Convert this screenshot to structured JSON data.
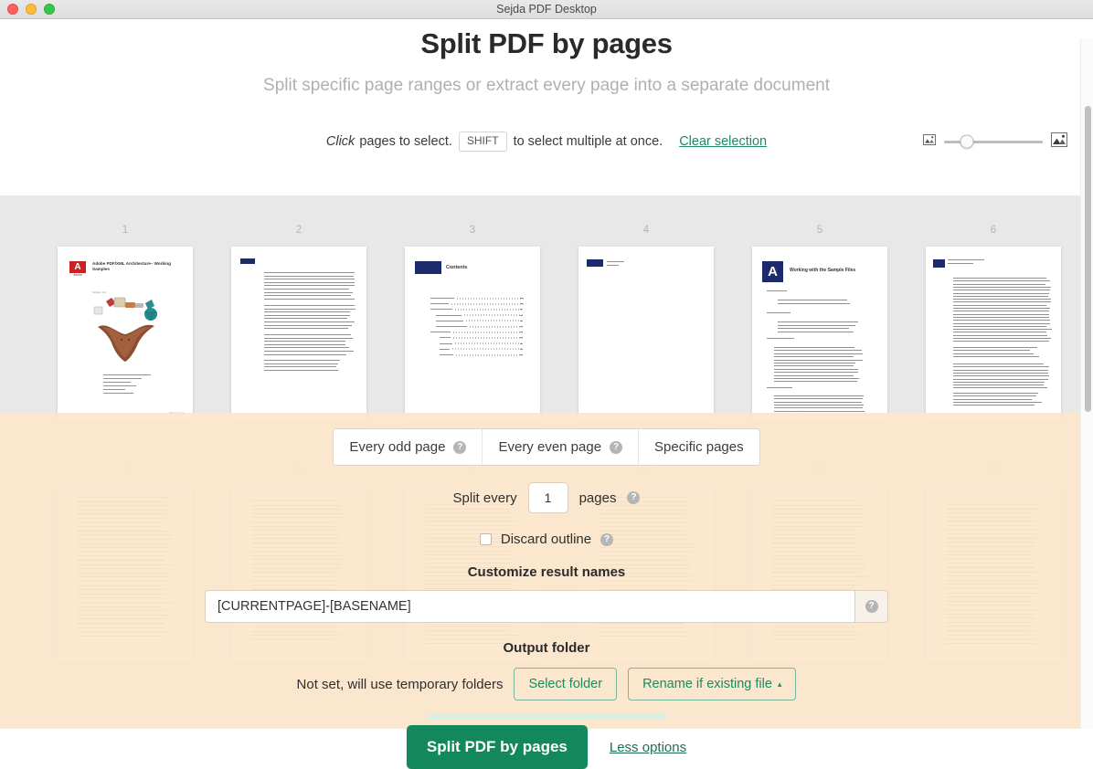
{
  "window": {
    "title": "Sejda PDF Desktop",
    "traffic_lights": [
      "close-red",
      "minimize-yellow",
      "maximize-green"
    ]
  },
  "header": {
    "title": "Split PDF by pages",
    "subtitle": "Split specific page ranges or extract every page into a separate document"
  },
  "select_bar": {
    "click_word": "Click",
    "text_before_kbd": "pages to select.",
    "kbd": "SHIFT",
    "text_after_kbd": "to select multiple at once.",
    "clear_selection": "Clear selection",
    "zoom": {
      "small_icon": "image-small-icon",
      "large_icon": "image-large-icon",
      "value_percent": 23
    }
  },
  "thumbnails": {
    "row1": [
      {
        "number": "1",
        "kind": "cover",
        "title": "Adobe PDF/XML Architecture– Working Samples",
        "logo": "adobe-logo",
        "footer": "Page 1 of 1"
      },
      {
        "number": "2",
        "kind": "text-page"
      },
      {
        "number": "3",
        "kind": "contents",
        "heading": "Contents"
      },
      {
        "number": "4",
        "kind": "sparse-page"
      },
      {
        "number": "5",
        "kind": "chapter",
        "badge": "A",
        "heading": "Working with the Sample Files"
      },
      {
        "number": "6",
        "kind": "dense-text",
        "heading": "Working with the Sample Files"
      }
    ],
    "row2": [
      {
        "number": "7",
        "kind": "text-page"
      },
      {
        "number": "8",
        "kind": "text-page"
      },
      {
        "number": "9",
        "kind": "text-page"
      },
      {
        "number": "10",
        "kind": "text-page"
      },
      {
        "number": "11",
        "kind": "text-page"
      },
      {
        "number": "12",
        "kind": "text-page"
      }
    ]
  },
  "options": {
    "tabs": [
      {
        "label": "Every odd page",
        "has_help": true
      },
      {
        "label": "Every even page",
        "has_help": true
      },
      {
        "label": "Specific pages",
        "has_help": false
      }
    ],
    "split_every": {
      "label_before": "Split every",
      "value": "1",
      "label_after": "pages",
      "has_help": true
    },
    "discard_outline": {
      "label": "Discard outline",
      "checked": false,
      "has_help": true
    },
    "customize_result_names": {
      "label": "Customize result names",
      "value": "[CURRENTPAGE]-[BASENAME]",
      "placeholder": "[CURRENTPAGE]-[BASENAME]",
      "has_help": true
    },
    "output_folder": {
      "label": "Output folder",
      "status": "Not set, will use temporary folders",
      "select_folder_label": "Select folder",
      "existing_file_label": "Rename if existing file",
      "existing_file_caret": "▴"
    },
    "actions": {
      "primary_label": "Split PDF by pages",
      "secondary_label": "Less options"
    }
  },
  "colors": {
    "accent_green": "#12885c",
    "link_green": "#1d8b62",
    "overlay_orange": "#fce5cb",
    "thumb_area_gray": "#e8e8e8",
    "navy": "#1b2a6b",
    "adobe_red": "#cc2027"
  }
}
